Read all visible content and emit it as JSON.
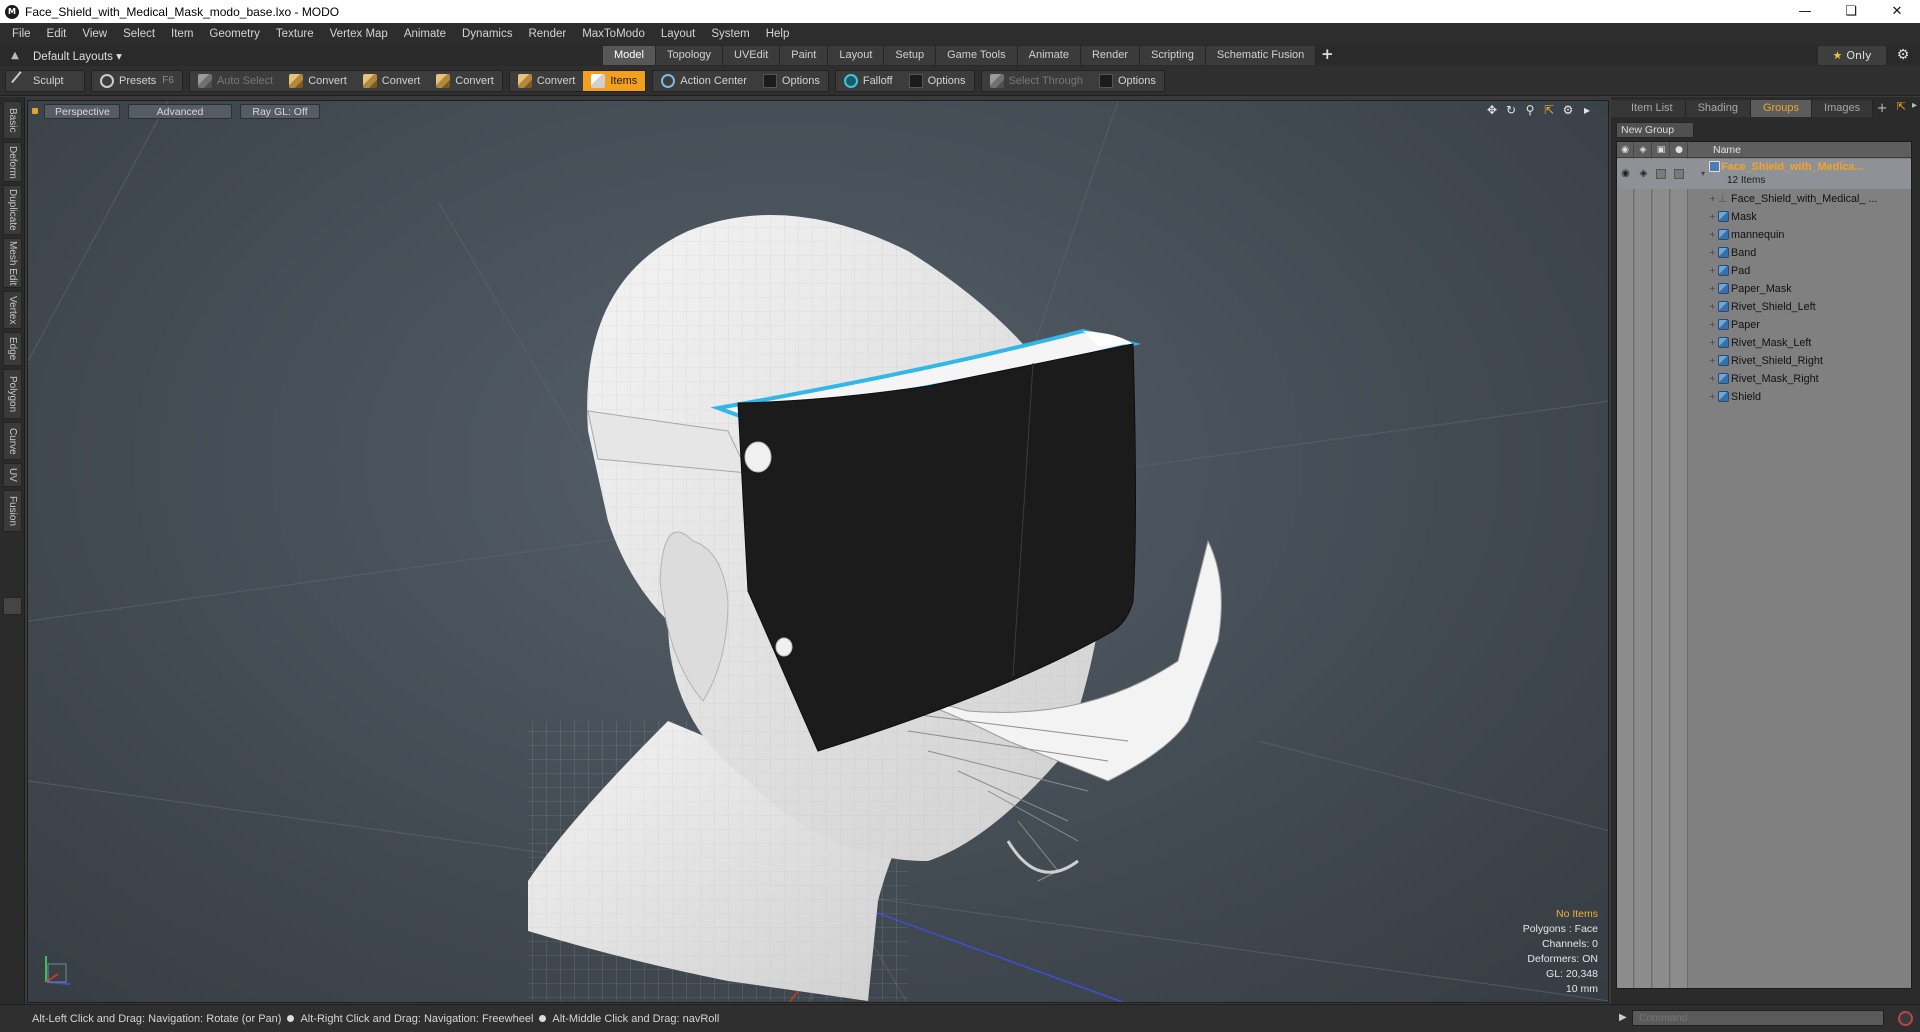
{
  "window": {
    "title": "Face_Shield_with_Medical_Mask_modo_base.lxo - MODO",
    "app_icon": "modo-logo-icon",
    "controls": [
      "minimize-icon",
      "restore-icon",
      "close-icon"
    ]
  },
  "menubar": {
    "items": [
      "File",
      "Edit",
      "Select",
      "View",
      "Item",
      "Geometry",
      "Texture",
      "Vertex Map",
      "Animate",
      "Dynamics",
      "Render",
      "MaxToModo",
      "Layout",
      "System",
      "Help"
    ]
  },
  "layoutbar": {
    "layout_label": "Default Layouts ▾",
    "tabs": [
      "Model",
      "Topology",
      "UVEdit",
      "Paint",
      "Layout",
      "Setup",
      "Game Tools",
      "Animate",
      "Render",
      "Scripting",
      "Schematic Fusion"
    ],
    "active_tab": "Model",
    "only_star": "★",
    "only_label": "Only"
  },
  "toolbar": {
    "sculpt": "Sculpt",
    "presets": "Presets",
    "presets_hotkey": "F6",
    "auto_select": "Auto Select",
    "convert1": "Convert",
    "convert2": "Convert",
    "convert3": "Convert",
    "convert4": "Convert",
    "items": "Items",
    "action_center": "Action Center",
    "options1": "Options",
    "falloff": "Falloff",
    "options2": "Options",
    "select_through": "Select Through",
    "options3": "Options"
  },
  "left_tabs": [
    "Basic",
    "Deform",
    "Duplicate",
    "Mesh Edit",
    "Vertex",
    "Edge",
    "Polygon",
    "Curve",
    "UV",
    "Fusion"
  ],
  "viewport": {
    "perspective": "Perspective",
    "advanced": "Advanced",
    "raygl": "Ray GL: Off",
    "info": {
      "no_items": "No Items",
      "polygons": "Polygons : Face",
      "channels": "Channels: 0",
      "deformers": "Deformers: ON",
      "gl": "GL: 20,348",
      "scale": "10 mm"
    },
    "colors": {
      "shield_edge": "#33b7e8",
      "shield_fill": "#1a1a1a",
      "head": "#e9e9e9"
    }
  },
  "right_panel": {
    "tabs": [
      "Item List",
      "Shading",
      "Groups",
      "Images"
    ],
    "active_tab": "Groups",
    "new_group": "New Group",
    "name_header": "Name",
    "group": {
      "name": "Face_Shield_with_Medica...",
      "count": "12 Items",
      "items": [
        {
          "label": "Face_Shield_with_Medical_ ...",
          "icon": "locator-icon"
        },
        {
          "label": "Mask",
          "icon": "mesh-icon"
        },
        {
          "label": "mannequin",
          "icon": "mesh-icon"
        },
        {
          "label": "Band",
          "icon": "mesh-icon"
        },
        {
          "label": "Pad",
          "icon": "mesh-icon"
        },
        {
          "label": "Paper_Mask",
          "icon": "mesh-icon"
        },
        {
          "label": "Rivet_Shield_Left",
          "icon": "mesh-icon"
        },
        {
          "label": "Paper",
          "icon": "mesh-icon"
        },
        {
          "label": "Rivet_Mask_Left",
          "icon": "mesh-icon"
        },
        {
          "label": "Rivet_Shield_Right",
          "icon": "mesh-icon"
        },
        {
          "label": "Rivet_Mask_Right",
          "icon": "mesh-icon"
        },
        {
          "label": "Shield",
          "icon": "mesh-icon"
        }
      ]
    }
  },
  "statusbar": {
    "hint1": "Alt-Left Click and Drag: Navigation: Rotate (or Pan)",
    "hint2": "Alt-Right Click and Drag: Navigation: Freewheel",
    "hint3": "Alt-Middle Click and Drag: navRoll"
  },
  "command": {
    "placeholder": "Command"
  }
}
